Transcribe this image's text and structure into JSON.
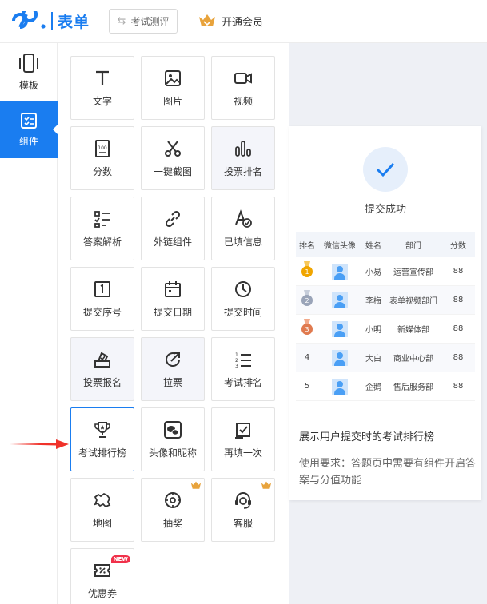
{
  "header": {
    "logo_text": "表单",
    "exam_button": "考试测评",
    "vip_label": "开通会员",
    "brand_color": "#1a7df0"
  },
  "leftnav": {
    "items": [
      {
        "label": "模板",
        "icon": "template-icon"
      },
      {
        "label": "组件",
        "icon": "component-icon",
        "active": true
      }
    ]
  },
  "components": [
    {
      "label": "文字",
      "icon": "text-icon"
    },
    {
      "label": "图片",
      "icon": "image-icon"
    },
    {
      "label": "视频",
      "icon": "video-icon"
    },
    {
      "label": "分数",
      "icon": "score-icon"
    },
    {
      "label": "一键截图",
      "icon": "scissors-icon"
    },
    {
      "label": "投票排名",
      "icon": "bar-chart-icon"
    },
    {
      "label": "答案解析",
      "icon": "answer-analysis-icon"
    },
    {
      "label": "外链组件",
      "icon": "link-icon"
    },
    {
      "label": "已填信息",
      "icon": "filled-info-icon"
    },
    {
      "label": "提交序号",
      "icon": "number-one-icon"
    },
    {
      "label": "提交日期",
      "icon": "calendar-icon"
    },
    {
      "label": "提交时间",
      "icon": "clock-icon"
    },
    {
      "label": "投票报名",
      "icon": "ballot-box-icon"
    },
    {
      "label": "拉票",
      "icon": "share-arrow-icon"
    },
    {
      "label": "考试排名",
      "icon": "ordered-list-icon"
    },
    {
      "label": "考试排行榜",
      "icon": "trophy-icon"
    },
    {
      "label": "头像和昵称",
      "icon": "wechat-avatar-icon"
    },
    {
      "label": "再填一次",
      "icon": "refill-icon"
    },
    {
      "label": "地图",
      "icon": "map-icon"
    },
    {
      "label": "抽奖",
      "icon": "lottery-icon"
    },
    {
      "label": "客服",
      "icon": "customer-service-icon"
    },
    {
      "label": "优惠券",
      "icon": "coupon-icon",
      "badge": "NEW"
    }
  ],
  "preview": {
    "success_text": "提交成功",
    "table": {
      "headers": [
        "排名",
        "微信头像",
        "姓名",
        "部门",
        "分数"
      ],
      "rows": [
        {
          "rank": "1",
          "name": "小易",
          "dept": "运营宣传部",
          "score": "88"
        },
        {
          "rank": "2",
          "name": "李梅",
          "dept": "表单视频部门",
          "score": "88"
        },
        {
          "rank": "3",
          "name": "小明",
          "dept": "新媒体部",
          "score": "88"
        },
        {
          "rank": "4",
          "name": "大白",
          "dept": "商业中心部",
          "score": "88"
        },
        {
          "rank": "5",
          "name": "企鹅",
          "dept": "售后服务部",
          "score": "88"
        }
      ]
    },
    "description": "展示用户提交时的考试排行榜",
    "requirement": "使用要求：答题页中需要有组件开启答案与分值功能"
  },
  "colors": {
    "accent": "#1a7df0",
    "gold": "#f0a500",
    "silver": "#9aa4b8",
    "bronze": "#e07a4f",
    "arrow": "#f0322a",
    "vip": "#e8a33c"
  }
}
